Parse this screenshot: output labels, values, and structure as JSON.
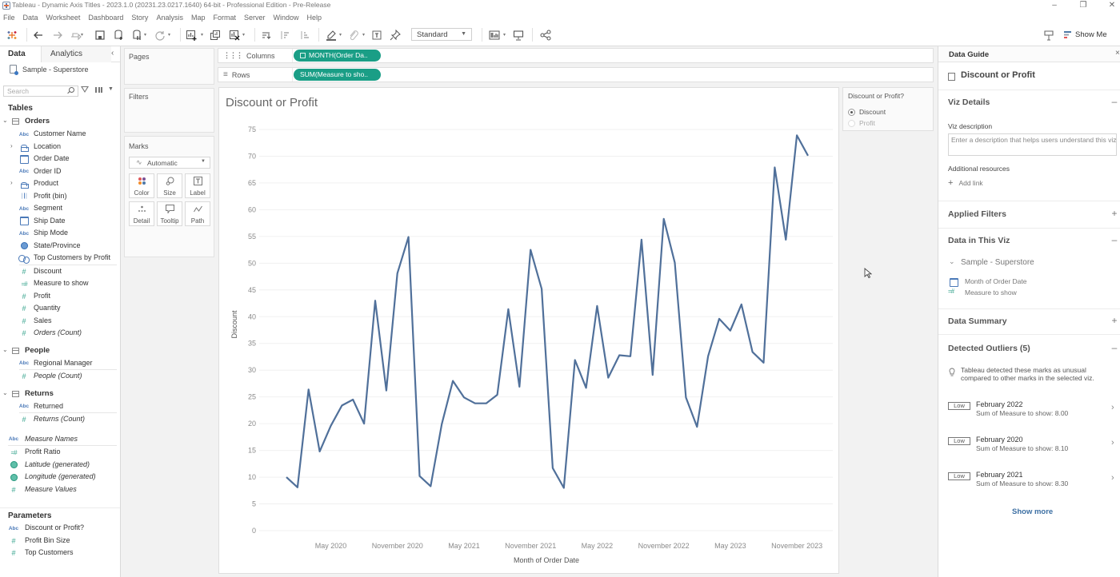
{
  "window": {
    "title": "Tableau - Dynamic Axis Titles - 2023.1.0 (20231.23.0217.1640) 64-bit - Professional Edition - Pre-Release",
    "controls": [
      "minimize-icon",
      "restore-icon",
      "close-icon"
    ]
  },
  "menu": [
    "File",
    "Data",
    "Worksheet",
    "Dashboard",
    "Story",
    "Analysis",
    "Map",
    "Format",
    "Server",
    "Window",
    "Help"
  ],
  "toolbar": {
    "icons": [
      "tableau-logo-icon",
      "undo-icon",
      "redo-icon",
      "replay-animation-icon",
      "save-icon",
      "new-data-source-icon",
      "pause-auto-updates-icon",
      "refresh-icon",
      "new-worksheet-icon",
      "duplicate-sheet-icon",
      "clear-sheet-icon",
      "swap-rows-columns-icon",
      "sort-ascending-icon",
      "sort-descending-icon",
      "highlight-icon",
      "group-members-icon",
      "show-mark-labels-icon",
      "fix-axes-icon",
      "show-hide-cards-icon",
      "presentation-mode-icon",
      "share-icon",
      "data-guide-icon",
      "show-me-icon"
    ],
    "fit_value": "Standard",
    "show_me_label": "Show Me"
  },
  "data_pane": {
    "tabs": [
      "Data",
      "Analytics"
    ],
    "active_tab": "Data",
    "datasource": "Sample - Superstore",
    "search_placeholder": "Search",
    "tables_heading": "Tables",
    "groups": [
      {
        "name": "Orders",
        "expanded": true,
        "fields": [
          {
            "name": "Customer Name",
            "type": "string"
          },
          {
            "name": "Location",
            "type": "hierarchy",
            "expandable": true
          },
          {
            "name": "Order Date",
            "type": "date"
          },
          {
            "name": "Order ID",
            "type": "string"
          },
          {
            "name": "Product",
            "type": "hierarchy",
            "expandable": true
          },
          {
            "name": "Profit (bin)",
            "type": "bin"
          },
          {
            "name": "Segment",
            "type": "string"
          },
          {
            "name": "Ship Date",
            "type": "date"
          },
          {
            "name": "Ship Mode",
            "type": "string"
          },
          {
            "name": "State/Province",
            "type": "geo"
          },
          {
            "name": "Top Customers by Profit",
            "type": "set"
          },
          {
            "name": "Discount",
            "type": "measure"
          },
          {
            "name": "Measure to show",
            "type": "calculated-measure"
          },
          {
            "name": "Profit",
            "type": "measure"
          },
          {
            "name": "Quantity",
            "type": "measure"
          },
          {
            "name": "Sales",
            "type": "measure"
          },
          {
            "name": "Orders (Count)",
            "type": "measure",
            "generated": true
          }
        ]
      },
      {
        "name": "People",
        "expanded": true,
        "fields": [
          {
            "name": "Regional Manager",
            "type": "string"
          },
          {
            "name": "People (Count)",
            "type": "measure",
            "generated": true
          }
        ]
      },
      {
        "name": "Returns",
        "expanded": true,
        "fields": [
          {
            "name": "Returned",
            "type": "string"
          },
          {
            "name": "Returns (Count)",
            "type": "measure",
            "generated": true
          }
        ]
      }
    ],
    "other_fields": [
      {
        "name": "Measure Names",
        "type": "string",
        "generated": true
      },
      {
        "name": "Profit Ratio",
        "type": "calculated-measure"
      },
      {
        "name": "Latitude (generated)",
        "type": "geo",
        "generated": true
      },
      {
        "name": "Longitude (generated)",
        "type": "geo",
        "generated": true
      },
      {
        "name": "Measure Values",
        "type": "measure",
        "generated": true
      }
    ],
    "parameters_heading": "Parameters",
    "parameters": [
      {
        "name": "Discount or Profit?",
        "type": "string"
      },
      {
        "name": "Profit Bin Size",
        "type": "measure"
      },
      {
        "name": "Top Customers",
        "type": "measure"
      }
    ]
  },
  "cards": {
    "pages": "Pages",
    "filters": "Filters",
    "marks": {
      "title": "Marks",
      "mark_type": "Automatic",
      "buttons": [
        "Color",
        "Size",
        "Label",
        "Detail",
        "Tooltip",
        "Path"
      ]
    }
  },
  "shelves": {
    "columns": {
      "label": "Columns",
      "pill": "MONTH(Order Da.."
    },
    "rows": {
      "label": "Rows",
      "pill": "SUM(Measure to sho.."
    }
  },
  "parameter_card": {
    "title": "Discount or Profit?",
    "options": [
      "Discount",
      "Profit"
    ],
    "selected": "Discount"
  },
  "data_guide": {
    "header": "Data Guide",
    "viz_title": "Discount or Profit",
    "viz_details": {
      "title": "Viz Details",
      "expanded": true,
      "description_label": "Viz description",
      "description_placeholder": "Enter a description that helps users understand this viz",
      "resources_label": "Additional resources",
      "add_link": "Add link"
    },
    "applied_filters": {
      "title": "Applied Filters",
      "expanded": false
    },
    "data_in_viz": {
      "title": "Data in This Viz",
      "expanded": true,
      "datasource": "Sample - Superstore",
      "fields": [
        {
          "name": "Month of Order Date",
          "type": "date"
        },
        {
          "name": "Measure to show",
          "type": "calculated-measure"
        }
      ]
    },
    "data_summary": {
      "title": "Data Summary",
      "expanded": false
    },
    "outliers": {
      "title": "Detected Outliers (5)",
      "expanded": true,
      "note": "Tableau detected these marks as unusual compared to other marks in the selected viz.",
      "items": [
        {
          "badge": "Low",
          "title": "February 2022",
          "detail": "Sum of Measure to show: 8.00"
        },
        {
          "badge": "Low",
          "title": "February 2020",
          "detail": "Sum of Measure to show: 8.10"
        },
        {
          "badge": "Low",
          "title": "February 2021",
          "detail": "Sum of Measure to show: 8.30"
        }
      ],
      "show_more": "Show more"
    }
  },
  "colors": {
    "pill": "#1a9e86",
    "line": "#50709a",
    "dimension_icon": "#4a79b8",
    "measure_icon": "#3aa58f"
  },
  "chart_data": {
    "type": "line",
    "title": "Discount or Profit",
    "xlabel": "Month of Order Date",
    "ylabel": "Discount",
    "ylim": [
      0,
      75
    ],
    "y_ticks": [
      0,
      5,
      10,
      15,
      20,
      25,
      30,
      35,
      40,
      45,
      50,
      55,
      60,
      65,
      70,
      75
    ],
    "x_tick_labels": [
      "May 2020",
      "November 2020",
      "May 2021",
      "November 2021",
      "May 2022",
      "November 2022",
      "May 2023",
      "November 2023"
    ],
    "grid": true,
    "legend": "none",
    "categories": [
      "January 2020",
      "February 2020",
      "March 2020",
      "April 2020",
      "May 2020",
      "June 2020",
      "July 2020",
      "August 2020",
      "September 2020",
      "October 2020",
      "November 2020",
      "December 2020",
      "January 2021",
      "February 2021",
      "March 2021",
      "April 2021",
      "May 2021",
      "June 2021",
      "July 2021",
      "August 2021",
      "September 2021",
      "October 2021",
      "November 2021",
      "December 2021",
      "January 2022",
      "February 2022",
      "March 2022",
      "April 2022",
      "May 2022",
      "June 2022",
      "July 2022",
      "August 2022",
      "September 2022",
      "October 2022",
      "November 2022",
      "December 2022",
      "January 2023",
      "February 2023",
      "March 2023",
      "April 2023",
      "May 2023",
      "June 2023",
      "July 2023",
      "August 2023",
      "September 2023",
      "October 2023",
      "November 2023",
      "December 2023"
    ],
    "series": [
      {
        "name": "SUM(Measure to show)",
        "values": [
          10.0,
          8.1,
          26.4,
          14.8,
          19.6,
          23.4,
          24.5,
          20.0,
          43.0,
          26.2,
          48.1,
          54.9,
          10.2,
          8.3,
          19.9,
          28.0,
          24.9,
          23.8,
          23.8,
          25.4,
          41.4,
          26.9,
          52.5,
          45.2,
          11.7,
          8.0,
          31.9,
          26.7,
          42.0,
          28.6,
          32.8,
          32.6,
          54.4,
          29.1,
          58.3,
          50.1,
          24.9,
          19.4,
          32.6,
          39.6,
          37.4,
          42.3,
          33.4,
          31.4,
          67.9,
          54.4,
          73.9,
          70.1
        ]
      }
    ]
  }
}
